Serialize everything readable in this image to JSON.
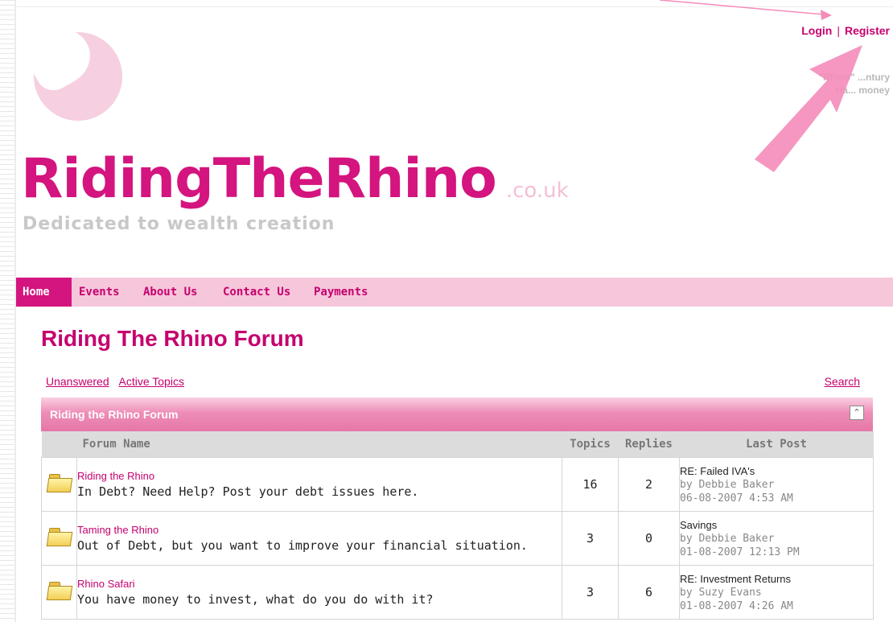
{
  "header": {
    "login_label": "Login",
    "separator": "|",
    "register_label": "Register",
    "tagline_line1": "\"Rhino\" ...ntury",
    "tagline_line2": "sla... money",
    "brand_name": "RidingTheRhino",
    "brand_tld": ".co.uk",
    "subtitle": "Dedicated to wealth creation"
  },
  "nav": {
    "home": "Home",
    "events": "Events",
    "about": "About Us",
    "contact": "Contact Us",
    "payments": "Payments"
  },
  "page_title": "Riding The Rhino Forum",
  "links": {
    "unanswered": "Unanswered",
    "active_topics": "Active Topics",
    "search": "Search"
  },
  "panel": {
    "title": "Riding the Rhino Forum",
    "collapse_icon": "^"
  },
  "columns": {
    "forum_name": "Forum Name",
    "topics": "Topics",
    "replies": "Replies",
    "last_post": "Last Post"
  },
  "forums": [
    {
      "name": "Riding the Rhino",
      "description": "In Debt? Need Help? Post your debt issues here.",
      "topics": "16",
      "replies": "2",
      "last_title": "RE: Failed IVA's",
      "last_by": "by Debbie Baker",
      "last_date": "06-08-2007 4:53 AM"
    },
    {
      "name": "Taming the Rhino",
      "description": "Out of Debt, but you want to improve your financial situation.",
      "topics": "3",
      "replies": "0",
      "last_title": "Savings",
      "last_by": "by Debbie Baker",
      "last_date": "01-08-2007 12:13 PM"
    },
    {
      "name": "Rhino Safari",
      "description": "You have money to invest, what do you do with it?",
      "topics": "3",
      "replies": "6",
      "last_title": "RE: Investment Returns",
      "last_by": "by Suzy Evans",
      "last_date": "01-08-2007 4:26 AM"
    }
  ],
  "colors": {
    "brand_pink": "#d4147f",
    "nav_bg": "#f6c7db",
    "annotation_arrow": "#f48cb9"
  }
}
